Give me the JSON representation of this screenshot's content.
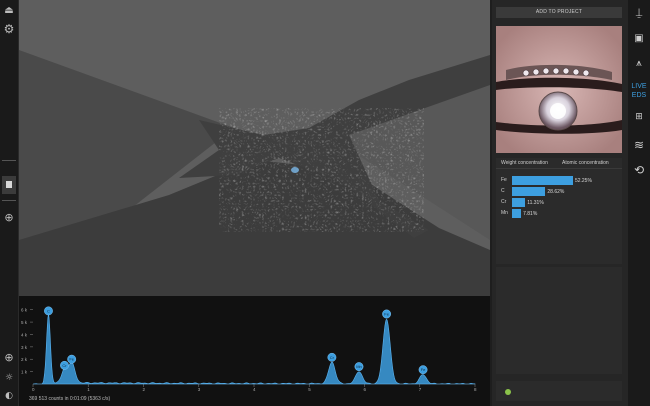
{
  "toolbar_left": {
    "icons": [
      "eject-icon",
      "settings-icon",
      "stop-icon",
      "crosshair-icon",
      "zoom-in-icon",
      "brightness-icon",
      "contrast-icon"
    ]
  },
  "spectrum": {
    "counts_text": "369 513 counts in 0:01:09 (5363 c/s)",
    "y_ticks": [
      "6 k",
      "5 k",
      "4 k",
      "3 k",
      "2 k",
      "1 k"
    ],
    "x_ticks": [
      "0",
      "1",
      "2",
      "3",
      "4",
      "5",
      "6",
      "7",
      "8"
    ],
    "peaks": [
      {
        "label": "C",
        "energy": 0.28,
        "height": 5.5
      },
      {
        "label": "Cr",
        "energy": 0.57,
        "height": 1.1
      },
      {
        "label": "Fe",
        "energy": 0.7,
        "height": 1.6
      },
      {
        "label": "Cr",
        "energy": 5.41,
        "height": 1.75
      },
      {
        "label": "Mn",
        "energy": 5.9,
        "height": 1.0
      },
      {
        "label": "Fe",
        "energy": 6.4,
        "height": 5.25
      },
      {
        "label": "Fe",
        "energy": 7.06,
        "height": 0.75
      }
    ]
  },
  "right_panel": {
    "add_button": "ADD TO PROJECT",
    "tab_weight": "Weight concentration",
    "tab_atomic": "Atomic concentration",
    "elements": [
      {
        "symbol": "Fe",
        "value": 52.25,
        "label": "52.25%"
      },
      {
        "symbol": "C",
        "value": 28.62,
        "label": "28.62%"
      },
      {
        "symbol": "Cr",
        "value": 11.31,
        "label": "11.31%"
      },
      {
        "symbol": "Mn",
        "value": 7.81,
        "label": "7.81%"
      }
    ]
  },
  "toolbar_right": {
    "live_label_1": "LIVE",
    "live_label_2": "EDS",
    "icons": [
      "probe-icon",
      "image-icon",
      "spectrum-icon",
      "grid-icon",
      "layers-icon",
      "rotate-icon"
    ]
  },
  "colors": {
    "accent": "#3d9fe0",
    "status": "#8bc34a"
  }
}
